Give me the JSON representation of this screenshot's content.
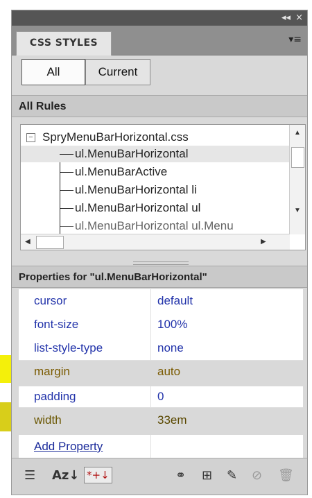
{
  "panel": {
    "title_controls": [
      "◂◂",
      "×"
    ],
    "tab_label": "CSS STYLES",
    "menu_icon": "panel-menu-icon"
  },
  "toggles": {
    "all": "All",
    "current": "Current"
  },
  "all_rules": {
    "header": "All Rules",
    "tree": {
      "root": "SpryMenuBarHorizontal.css",
      "root_expander": "−",
      "children": [
        "ul.MenuBarHorizontal",
        "ul.MenuBarActive",
        "ul.MenuBarHorizontal li",
        "ul.MenuBarHorizontal ul",
        "ul.MenuBarHorizontal ul.Menu"
      ],
      "selected_index": 0
    }
  },
  "properties": {
    "header": "Properties for \"ul.MenuBarHorizontal\"",
    "rows": [
      {
        "name": "cursor",
        "value": "default"
      },
      {
        "name": "font-size",
        "value": "100%"
      },
      {
        "name": "list-style-type",
        "value": "none"
      },
      {
        "name": "margin",
        "value": "auto"
      },
      {
        "name": "padding",
        "value": "0"
      },
      {
        "name": "width",
        "value": "33em"
      }
    ],
    "add_property": "Add Property"
  },
  "bottom_toolbar": {
    "icons": [
      "show-category-view-icon",
      "show-alphabetical-view-icon",
      "show-set-properties-icon",
      "attach-style-sheet-icon",
      "new-css-rule-icon",
      "edit-rule-icon",
      "disable-property-icon",
      "delete-rule-icon"
    ],
    "az_label": "Az↓",
    "set_label": "*+↓"
  },
  "colors": {
    "highlight_light": "#f4f00a",
    "highlight_dark": "#d8ce1a",
    "property_text": "#2233aa"
  }
}
